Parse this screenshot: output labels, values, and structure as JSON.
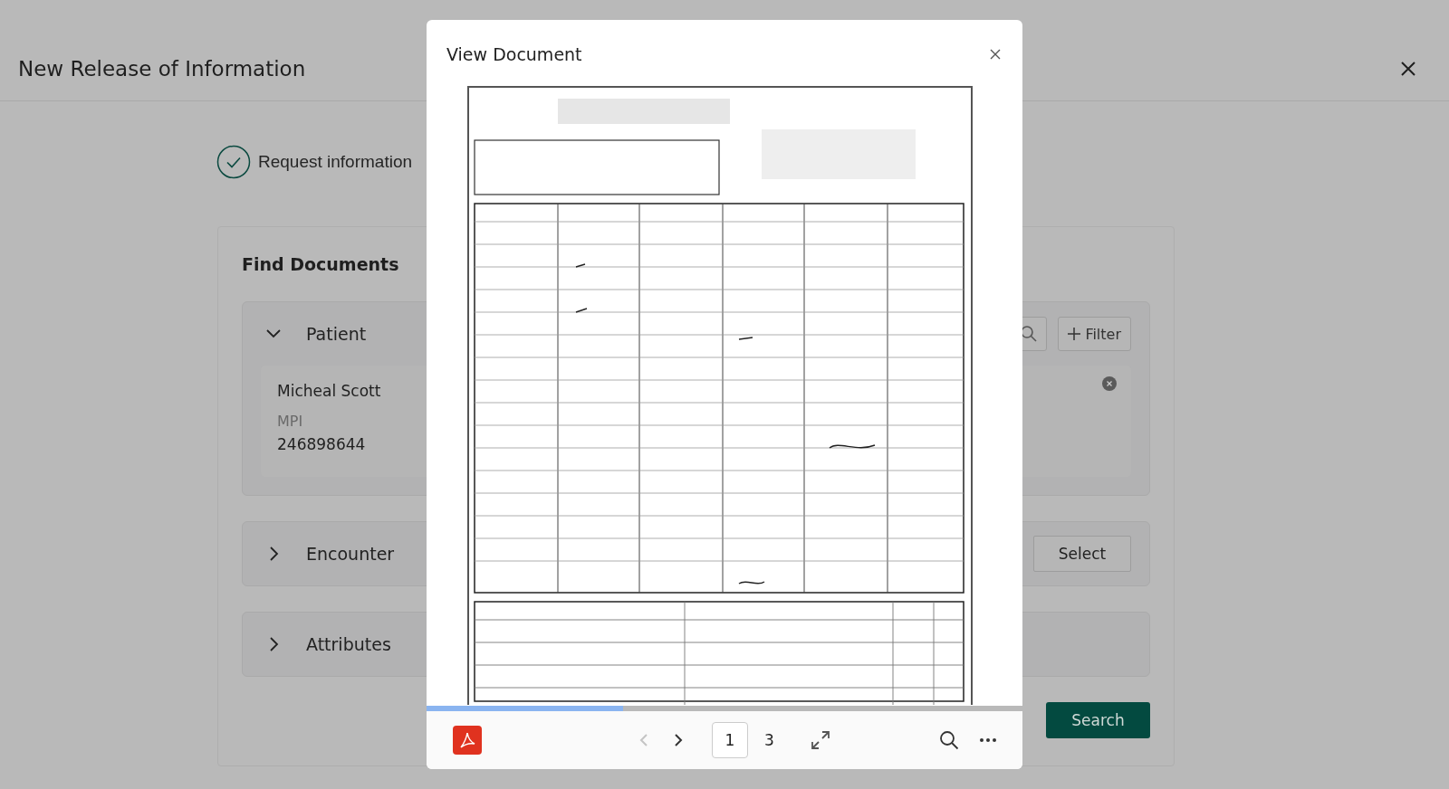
{
  "page": {
    "title": "New Release of Information"
  },
  "steps": [
    {
      "label": "Request information",
      "done": true
    }
  ],
  "find_documents": {
    "title": "Find Documents",
    "sections": [
      {
        "kind": "patient",
        "title": "Patient",
        "expanded": true,
        "filter_button": "Filter",
        "patient": {
          "name": "Micheal Scott",
          "id_label": "MPI",
          "id_value": "246898644"
        }
      },
      {
        "kind": "select",
        "title": "Encounter",
        "expanded": false,
        "action": "Select"
      },
      {
        "kind": "plain",
        "title": "Attributes",
        "expanded": false
      }
    ],
    "search_button": "Search"
  },
  "dialog": {
    "title": "View Document",
    "progress": {
      "level": 0.33
    },
    "pager": {
      "current": "1",
      "total": "3",
      "prev_disabled": true
    }
  }
}
